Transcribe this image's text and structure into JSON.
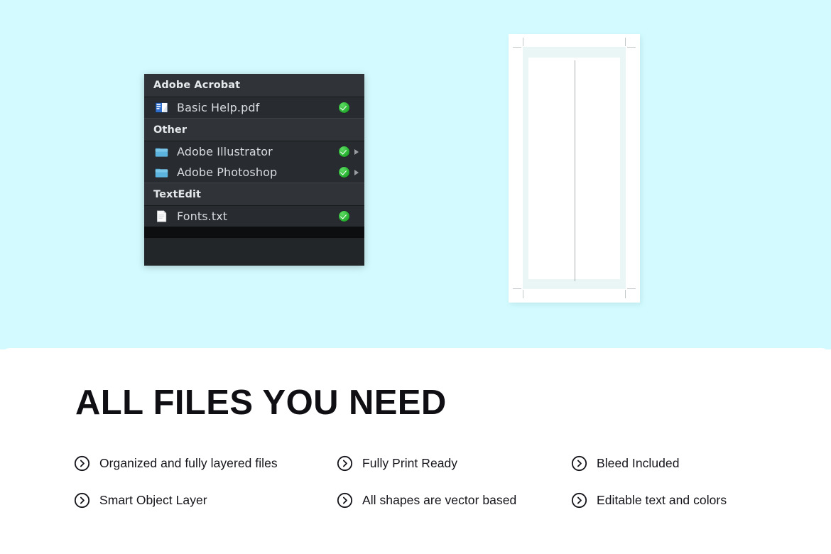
{
  "theme": {
    "hero_background": "#d3fbff",
    "sheet_background": "#ffffff",
    "panel_background": "#282c30",
    "panel_header_background": "#303438",
    "panel_footer_background": "#0c0e0f",
    "accent_check_green": "#2cb635",
    "folder_blue": "#5cb3dd",
    "headline_color": "#100f13",
    "text_color": "#15141a"
  },
  "file_panel": {
    "name": "file-browser-panel",
    "sections": [
      {
        "header": "Adobe Acrobat",
        "items": [
          {
            "label": "Basic Help.pdf",
            "icon": "pdf-file-icon",
            "status": "check-badge",
            "has_disclosure": false
          }
        ]
      },
      {
        "header": "Other",
        "items": [
          {
            "label": "Adobe Illustrator",
            "icon": "folder-icon",
            "status": "check-badge",
            "has_disclosure": true
          },
          {
            "label": "Adobe Photoshop",
            "icon": "folder-icon",
            "status": "check-badge",
            "has_disclosure": true
          }
        ]
      },
      {
        "header": "TextEdit",
        "items": [
          {
            "label": "Fonts.txt",
            "icon": "text-file-icon",
            "status": "check-badge",
            "has_disclosure": false
          }
        ]
      }
    ]
  },
  "document_preview": {
    "name": "artboard-preview",
    "description": "print document mockup with crop marks and center fold line",
    "page_background": "#ffffff",
    "bleed_band_color": "#e9f6f5",
    "crop_mark_color": "#c3c8ca",
    "fold_line_color": "#8d9396"
  },
  "content": {
    "headline": "ALL FILES YOU NEED",
    "features": [
      {
        "label": "Organized and fully layered files",
        "icon": "chevron-right-circle-icon"
      },
      {
        "label": "Fully Print Ready",
        "icon": "chevron-right-circle-icon"
      },
      {
        "label": "Bleed Included",
        "icon": "chevron-right-circle-icon"
      },
      {
        "label": "Smart Object Layer",
        "icon": "chevron-right-circle-icon"
      },
      {
        "label": "All shapes are vector based",
        "icon": "chevron-right-circle-icon"
      },
      {
        "label": "Editable text and colors",
        "icon": "chevron-right-circle-icon"
      }
    ]
  }
}
